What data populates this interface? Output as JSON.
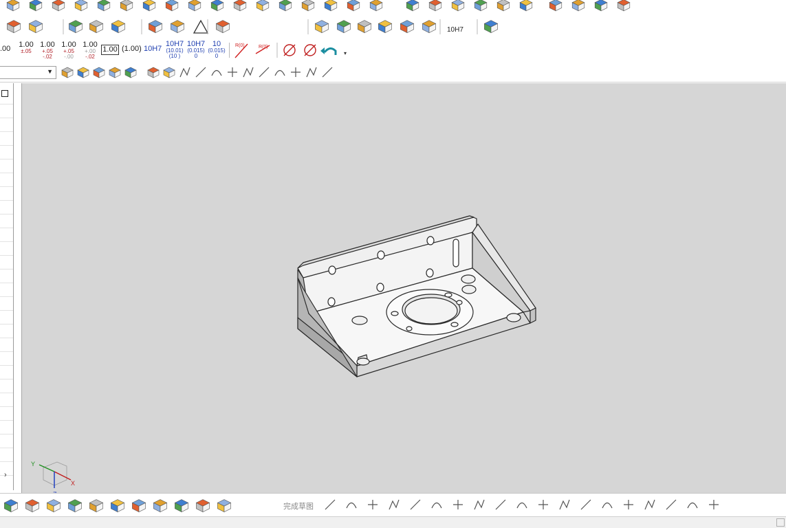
{
  "app": {
    "accent": "#1f3fb0",
    "tolerance_color": "#b2222a"
  },
  "dimension_toolbar": {
    "items": [
      {
        "main": ".00",
        "tol": ""
      },
      {
        "main": "1.00",
        "tol": "±.05"
      },
      {
        "main": "1.00",
        "tol1": "+.05",
        "tol2": "-.02"
      },
      {
        "main": "1.00",
        "tol1": "+.05",
        "tol2": "-.00"
      },
      {
        "main": "1.00",
        "tol1": "+.00",
        "tol2": "-.02"
      },
      {
        "main": "1.00",
        "style": "boxed"
      },
      {
        "main": "(1.00)",
        "style": "reference"
      },
      {
        "main": "10H7",
        "style": "fit"
      },
      {
        "main": "10H7",
        "tol1": "(10.01)",
        "tol2": "(10  )"
      },
      {
        "main": "10H7",
        "tol1": "(0.015)",
        "tol2": "0"
      },
      {
        "main": "10",
        "tol1": "(0.015)",
        "tol2": "0"
      }
    ],
    "radius_label_1": "R(0)",
    "radius_label_2": "R(0)"
  },
  "row2_fit_label": "10H7",
  "sketch_toolbar": {
    "finish_sketch_label": "完成草图"
  },
  "triad": {
    "x": "X",
    "y": "Y",
    "z": "Z"
  },
  "icons": {
    "row1": [
      "part-icon",
      "extrude-icon",
      "pattern-icon",
      "array-icon",
      "shell-icon",
      "boolean-icon",
      "section-icon",
      "sweep-icon",
      "loft-icon",
      "fillet-icon",
      "chamfer-icon",
      "revolve-icon",
      "draft-icon",
      "surface-icon",
      "mirror-icon",
      "move-icon",
      "face-icon",
      "delete-face-icon",
      "split-icon",
      "offset-icon",
      "thicken-icon",
      "stitch-icon",
      "surface-patch-icon",
      "blend-icon",
      "warp-icon",
      "wrap-icon",
      "bend-icon"
    ],
    "row2": [
      "label-icon",
      "text-icon",
      "curve-icon",
      "spring-icon",
      "thread-icon",
      "coil-icon",
      "cable-icon",
      "triangle-icon",
      "table-icon",
      "annotate-icon",
      "balloon-icon",
      "note-icon",
      "weld-icon",
      "tolerance-icon",
      "assembly-icon",
      "component-icon"
    ],
    "row4": [
      "selector-dropdown",
      "filter-icon",
      "snap-icon",
      "smart-snap-icon",
      "box-select-icon",
      "box-view-icon",
      "solid-view-icon",
      "triad-icon",
      "line-icon",
      "spline-icon",
      "arc-icon",
      "point-icon",
      "center-icon",
      "circle-icon",
      "cross-icon",
      "pencil-icon",
      "render-icon",
      "grid-icon"
    ],
    "bottom": [
      "reorder-icon",
      "measure-icon",
      "assemble-icon",
      "stack-icon",
      "connect-icon",
      "material-icon",
      "link-icon",
      "clip-icon",
      "tree-icon",
      "package-icon",
      "sketch-icon",
      "finish-icon",
      "polyline-icon",
      "line-icon",
      "arc-icon",
      "circle-icon",
      "fillet-corner-icon",
      "chamfer-corner-icon",
      "rectangle-icon",
      "spline-icon",
      "point-icon",
      "offset-curve-icon",
      "trim-icon",
      "extend-icon",
      "split-curve-icon",
      "mirror-curve-icon",
      "constraint-icon",
      "dimension-icon",
      "projection-icon",
      "convert-icon",
      "reference-icon"
    ]
  }
}
